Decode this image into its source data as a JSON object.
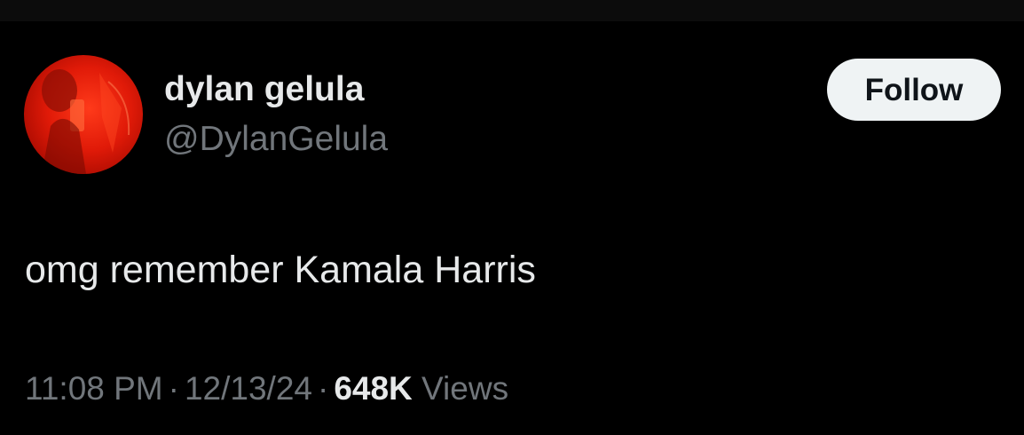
{
  "author": {
    "display_name": "dylan gelula",
    "handle": "@DylanGelula",
    "avatar_tint": "#e01a08"
  },
  "follow_button": {
    "label": "Follow"
  },
  "tweet": {
    "text": "omg remember Kamala Harris"
  },
  "meta": {
    "time": "11:08 PM",
    "separator": "·",
    "date": "12/13/24",
    "views_count": "648K",
    "views_label": "Views"
  },
  "colors": {
    "background": "#000000",
    "primary_text": "#e7e9ea",
    "secondary_text": "#71767b",
    "button_bg": "#eff3f4",
    "button_text": "#0f1419"
  }
}
